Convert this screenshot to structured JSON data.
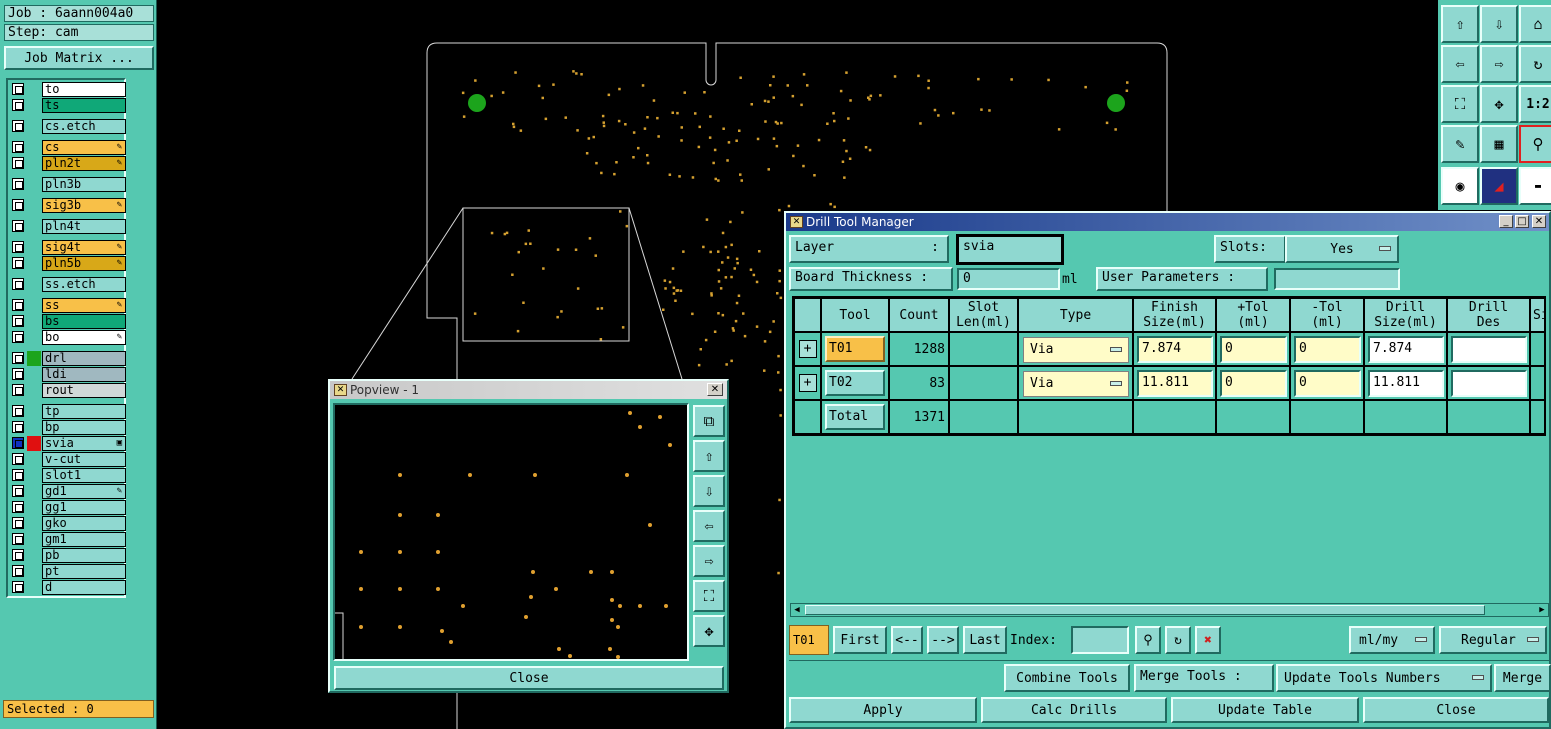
{
  "left_panel": {
    "job_label": "Job : 6aann004a0",
    "step_label": "Step: cam",
    "job_matrix_button": "Job Matrix ...",
    "layers": [
      {
        "name": "to",
        "color": "#ffffff",
        "mark": ""
      },
      {
        "name": "ts",
        "color": "#10a878",
        "mark": ""
      },
      {
        "name": "cs.etch",
        "color": "#8fd8d0",
        "mark": ""
      },
      {
        "name": "cs",
        "color": "#f8c048",
        "mark": "✎"
      },
      {
        "name": "pln2t",
        "color": "#d8a818",
        "mark": "✎"
      },
      {
        "name": "pln3b",
        "color": "#8fd8d0",
        "mark": ""
      },
      {
        "name": "sig3b",
        "color": "#f8c048",
        "mark": "✎"
      },
      {
        "name": "pln4t",
        "color": "#8fd8d0",
        "mark": ""
      },
      {
        "name": "sig4t",
        "color": "#f8c048",
        "mark": "✎"
      },
      {
        "name": "pln5b",
        "color": "#d8a818",
        "mark": "✎"
      },
      {
        "name": "ss.etch",
        "color": "#8fd8d0",
        "mark": ""
      },
      {
        "name": "ss",
        "color": "#f8c048",
        "mark": "✎"
      },
      {
        "name": "bs",
        "color": "#10a878",
        "mark": ""
      },
      {
        "name": "bo",
        "color": "#ffffff",
        "mark": "✎"
      },
      {
        "name": "drl",
        "color": "#a0b8c0",
        "mark": ""
      },
      {
        "name": "ldi",
        "color": "#a0b8c0",
        "mark": ""
      },
      {
        "name": "rout",
        "color": "#d0d8d8",
        "mark": ""
      },
      {
        "name": "tp",
        "color": "#8fd8d0",
        "mark": ""
      },
      {
        "name": "bp",
        "color": "#8fd8d0",
        "mark": ""
      },
      {
        "name": "svia",
        "color": "#8fd8d0",
        "mark": "▣"
      },
      {
        "name": "v-cut",
        "color": "#8fd8d0",
        "mark": ""
      },
      {
        "name": "slot1",
        "color": "#8fd8d0",
        "mark": ""
      },
      {
        "name": "gd1",
        "color": "#8fd8d0",
        "mark": "✎"
      },
      {
        "name": "gg1",
        "color": "#8fd8d0",
        "mark": ""
      },
      {
        "name": "gko",
        "color": "#8fd8d0",
        "mark": ""
      },
      {
        "name": "gm1",
        "color": "#8fd8d0",
        "mark": ""
      },
      {
        "name": "pb",
        "color": "#8fd8d0",
        "mark": ""
      },
      {
        "name": "pt",
        "color": "#8fd8d0",
        "mark": ""
      },
      {
        "name": "d",
        "color": "#8fd8d0",
        "mark": ""
      }
    ],
    "selected_label": "Selected : 0"
  },
  "toolbar": {
    "ratio_label": "1:2"
  },
  "popview": {
    "title": "Popview - 1",
    "close_label": "Close"
  },
  "drill_tool_manager": {
    "title": "Drill Tool Manager",
    "layer_label": "Layer",
    "layer_colon": ":",
    "layer_value": "svia",
    "slots_label": "Slots:",
    "slots_value": "Yes",
    "board_thickness_label": "Board Thickness :",
    "board_thickness_value": "0",
    "board_thickness_unit": "ml",
    "user_parameters_label": "User Parameters :",
    "user_parameters_value": "",
    "columns": [
      "Tool",
      "Count",
      "Slot\nLen(ml)",
      "Type",
      "Finish\nSize(ml)",
      "+Tol\n(ml)",
      "-Tol\n(ml)",
      "Drill\nSize(ml)",
      "Drill\nDes",
      "Si"
    ],
    "rows": [
      {
        "tool": "T01",
        "count": "1288",
        "slot_len": "",
        "type": "Via",
        "finish": "7.874",
        "plus_tol": "0",
        "minus_tol": "0",
        "drill_size": "7.874",
        "drill_des": ""
      },
      {
        "tool": "T02",
        "count": "83",
        "slot_len": "",
        "type": "Via",
        "finish": "11.811",
        "plus_tol": "0",
        "minus_tol": "0",
        "drill_size": "11.811",
        "drill_des": ""
      }
    ],
    "total_label": "Total",
    "total_count": "1371",
    "current_tool": "T01",
    "first_label": "First",
    "prev_label": "<--",
    "next_label": "-->",
    "last_label": "Last",
    "index_label": "Index:",
    "index_value": "",
    "units_value": "ml/my",
    "mode_value": "Regular",
    "combine_tools_label": "Combine Tools",
    "merge_tools_label": "Merge Tools :",
    "update_tools_numbers_label": "Update Tools Numbers",
    "merge_label": "Merge",
    "apply_label": "Apply",
    "calc_drills_label": "Calc Drills",
    "update_table_label": "Update Table",
    "close_label": "Close"
  },
  "colors": {
    "panel_teal": "#55c8b0",
    "button_teal": "#8fd8d0",
    "drill_dot": "#d4a030",
    "fiducial_green": "#1ca41c",
    "highlight_orange": "#f8c048"
  }
}
